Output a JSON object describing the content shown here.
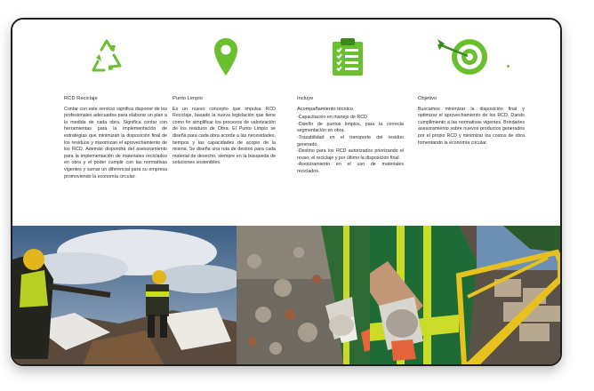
{
  "columns": [
    {
      "title": "RCD Reciclaje",
      "body": "Contar con este servicio significa disponer de los profesionales adecuados para elaborar un plan a la medida de cada obra. Significa contar con herramientas para la implementación de estrategias que minimizan la disposición final de los residuos y maximizan el aprovechamiento de los RCD. Además dispondrá del asesoramiento para la implementación de materiales reciclados en obra y el poder cumplir con las normativas vigentes y sumar un diferencial para su empresa promoviendo la economía circular."
    },
    {
      "title": "Punto Limpio",
      "body": "Es un nuevo concepto que impulsa RCD Reciclaje, basado la nueva legislación que tiene como fin simplificar los procesos de valorización de los residuos de Obra. El Punto Limpio se diseña para cada obra acorde a las necesidades, tiempos y las capacidades de acopio de la misma. Se diseña una ruta de destino para cada material de desecho, siempre en la búsqueda de soluciones sostenibles."
    },
    {
      "title": "Incluye",
      "subtitle": "Acompañamiento técnico.",
      "items": [
        "-Capacitación en manejo de RCD",
        "-Diseño de puntos limpios, para la correcta segmentación en obra.",
        "-Trazabilidad en el transporte del residuo generado.",
        "-Destino para los RCD autorizados priorizando el reuso, el reciclaje y por último la disposición final.",
        "-Asesoramiento en el uso de materiales reciclados."
      ]
    },
    {
      "title": "Objetivo",
      "body": "Buscamos minimizar la disposición final y optimizar el aprovechamiento de los RCD. Dando cumplimiento a las normativas vigentes. Brindarles asesoramiento sobre nuevos productos generados por el propio RCD y minimizar los costos de obra fomentando la economía circular."
    }
  ],
  "icons": [
    "recycle-icon",
    "location-pin-icon",
    "clipboard-checklist-icon",
    "target-arrow-icon"
  ],
  "colors": {
    "accent": "#6abf2f",
    "accent_dark": "#3d8a1a",
    "frame": "#1e1e1e"
  }
}
